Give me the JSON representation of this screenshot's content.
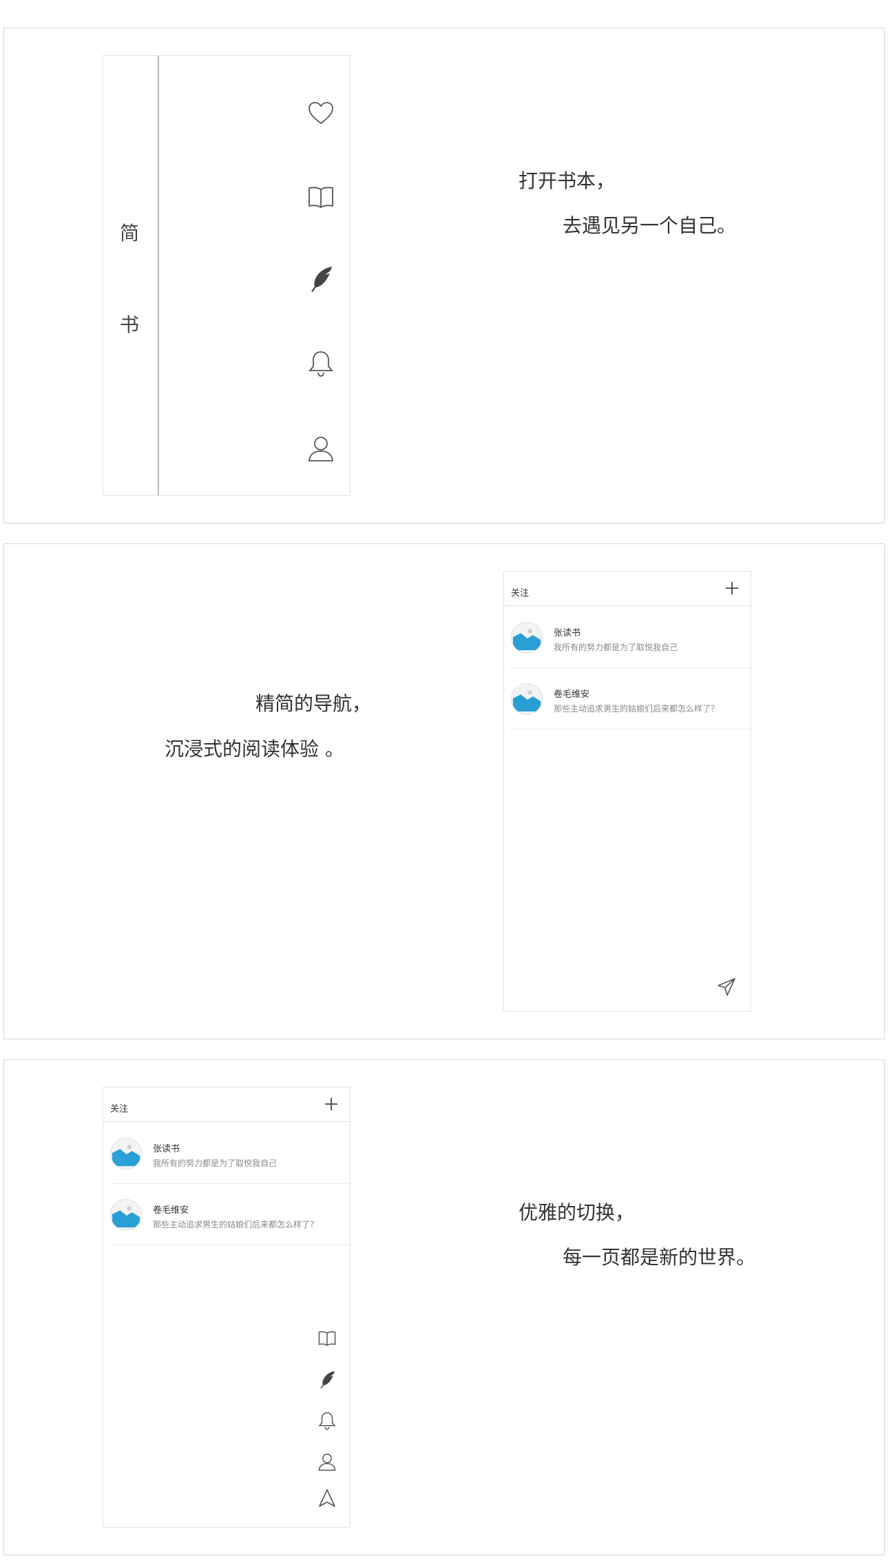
{
  "panel1": {
    "vertical_title": [
      "简",
      "书"
    ],
    "nav_icons": [
      "heart-icon",
      "book-icon",
      "feather-icon",
      "bell-icon",
      "user-icon"
    ],
    "tagline": [
      "打开书本，",
      "去遇见另一个自己。"
    ]
  },
  "panel2": {
    "tagline": [
      "精简的导航，",
      "沉浸式的阅读体验 。"
    ],
    "feed": {
      "title": "关注",
      "add_icon": "plus-icon",
      "send_icon": "send-icon",
      "items": [
        {
          "name": "张读书",
          "desc": "我所有的努力都是为了取悦我自己"
        },
        {
          "name": "卷毛维安",
          "desc": "那些主动追求男生的姑娘们后来都怎么样了？"
        }
      ]
    }
  },
  "panel3": {
    "tagline": [
      "优雅的切换，",
      "每一页都是新的世界。"
    ],
    "feed": {
      "title": "关注",
      "add_icon": "plus-icon",
      "items": [
        {
          "name": "张读书",
          "desc": "我所有的努力都是为了取悦我自己"
        },
        {
          "name": "卷毛维安",
          "desc": "那些主动追求男生的姑娘们后来都怎么样了？"
        }
      ]
    },
    "mini_nav_icons": [
      "book-icon",
      "feather-icon",
      "bell-icon",
      "user-icon",
      "send-icon"
    ]
  },
  "colors": {
    "avatar_blue": "#2a9fd6",
    "border": "#dcdcdc",
    "divider": "#bdbdbd"
  }
}
